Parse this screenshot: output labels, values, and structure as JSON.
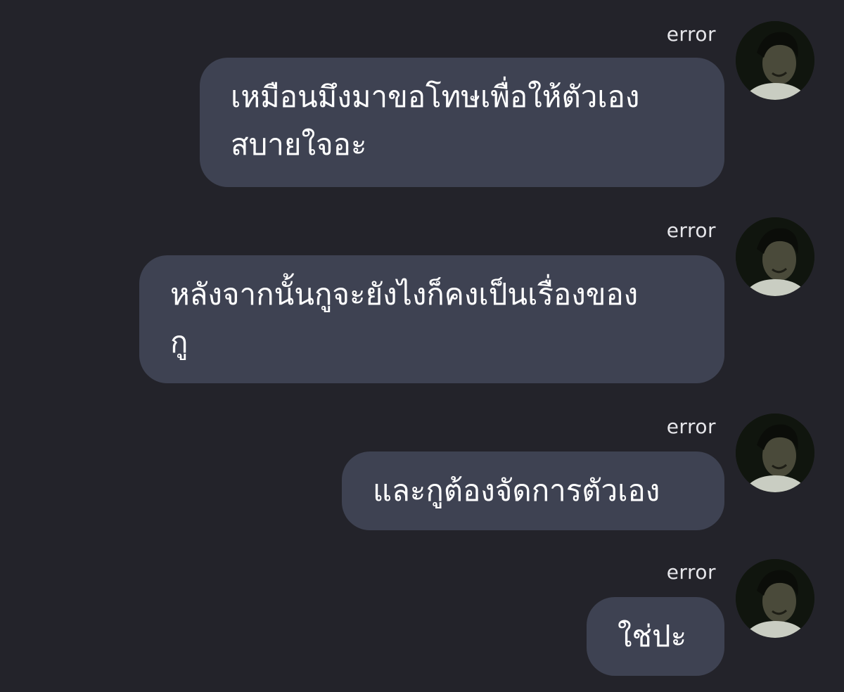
{
  "conversation": {
    "messages": [
      {
        "sender": "error",
        "avatar_icon": "user-avatar-photo",
        "text": "เหมือนมึงมาขอโทษเพื่อให้ตัวเอง\nสบายใจอะ"
      },
      {
        "sender": "error",
        "avatar_icon": "user-avatar-photo",
        "text": "หลังจากนั้นกูจะยังไงก็คงเป็นเรื่องของ\nกู"
      },
      {
        "sender": "error",
        "avatar_icon": "user-avatar-photo",
        "text": "และกูต้องจัดการตัวเอง"
      },
      {
        "sender": "error",
        "avatar_icon": "user-avatar-photo",
        "text": "ใช่ปะ"
      }
    ]
  },
  "colors": {
    "background": "#23232a",
    "bubble": "#3e4252",
    "text": "#ffffff",
    "sender_name": "#e6e6ea"
  }
}
